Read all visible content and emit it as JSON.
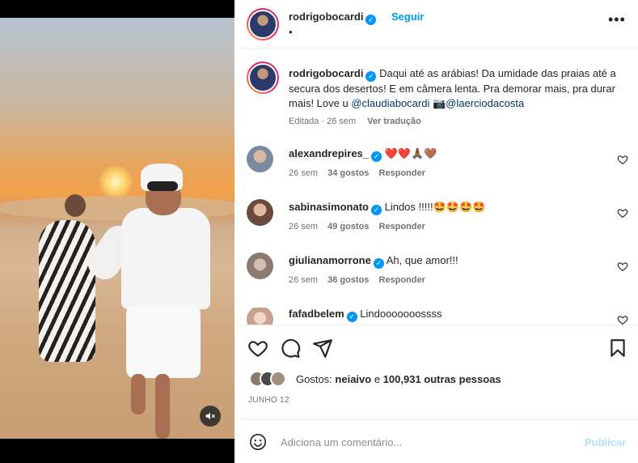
{
  "post": {
    "author": "rodrigobocardi",
    "follow_label": "Seguir",
    "bullet": "•",
    "more_label": "•••",
    "caption": {
      "text_1": "Daqui até as arábias! Da umidade das praias até a secura dos desertos! E em câmera lenta. Pra demorar mais, pra durar mais! Love u ",
      "mention_1": "@claudiabocardi",
      "camera_emoji": "📷",
      "mention_2": "@laerciodacosta",
      "edited": "Editada · 26 sem",
      "translate": "Ver tradução"
    }
  },
  "comments": [
    {
      "user": "alexandrepires_",
      "text": "❤️❤️🙏🏾🤎",
      "time": "26 sem",
      "likes": "34 gostos",
      "reply": "Responder"
    },
    {
      "user": "sabinasimonato",
      "text": "Lindos !!!!!🤩🤩🤩🤩",
      "time": "26 sem",
      "likes": "49 gostos",
      "reply": "Responder"
    },
    {
      "user": "giulianamorrone",
      "text": "Ah, que amor!!!",
      "time": "26 sem",
      "likes": "36 gostos",
      "reply": "Responder"
    },
    {
      "user": "fafadbelem",
      "text": "Lindooooooossss"
    }
  ],
  "likes": {
    "prefix": "Gostos: ",
    "user": "neiaivo",
    "middle": " e ",
    "others": "100,931 outras pessoas"
  },
  "date": "JUNHO 12",
  "comment_input": {
    "placeholder": "Adiciona um comentário...",
    "post_label": "Publicar"
  },
  "colors": {
    "accent": "#0095f6",
    "mention": "#00376b",
    "muted": "#737373",
    "like_red": "#ed4956"
  },
  "icons": [
    "verified-badge-icon",
    "more-options-icon",
    "heart-icon",
    "comment-icon",
    "share-icon",
    "bookmark-icon",
    "emoji-icon",
    "mute-icon"
  ]
}
